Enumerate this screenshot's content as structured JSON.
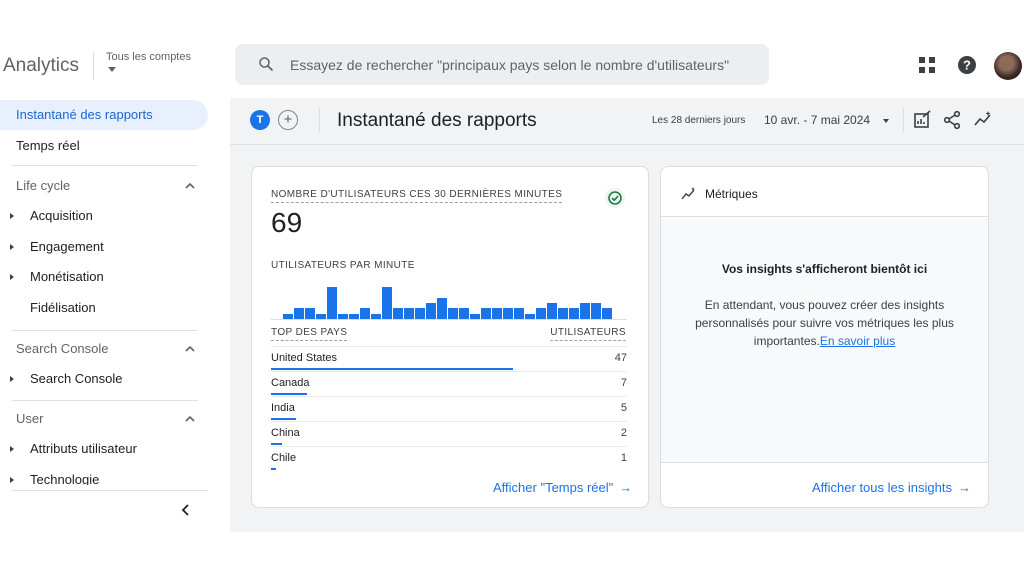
{
  "header": {
    "app_name": "Analytics",
    "account_label": "Tous les comptes",
    "search_placeholder": "Essayez de rechercher \"principaux pays selon le nombre d'utilisateurs\"",
    "icons": [
      "apps-grid-icon",
      "help-icon",
      "avatar"
    ]
  },
  "sidebar": {
    "items": [
      {
        "label": "Instantané des rapports",
        "active": true
      },
      {
        "label": "Temps réel",
        "active": false
      }
    ],
    "sections": [
      {
        "title": "Life cycle",
        "items": [
          "Acquisition",
          "Engagement",
          "Monétisation",
          "Fidélisation"
        ]
      },
      {
        "title": "Search Console",
        "items": [
          "Search Console"
        ]
      },
      {
        "title": "User",
        "items": [
          "Attributs utilisateur",
          "Technologie"
        ]
      }
    ]
  },
  "toolbar": {
    "badge_letter": "T",
    "add_symbol": "+",
    "title": "Instantané des rapports",
    "date_range_label": "Les 28 derniers jours",
    "date_range_value": "10 avr. - 7 mai 2024"
  },
  "realtime_card": {
    "kpi_label": "NOMBRE D'UTILISATEURS CES 30 DERNIÈRES MINUTES",
    "kpi_value": "69",
    "per_minute_label": "UTILISATEURS PAR MINUTE",
    "per_minute_values": [
      1,
      2,
      2,
      1,
      6,
      1,
      1,
      2,
      1,
      6,
      2,
      2,
      2,
      3,
      4,
      2,
      2,
      1,
      2,
      2,
      2,
      2,
      1,
      2,
      3,
      2,
      2,
      3,
      3,
      2
    ],
    "table_headers": {
      "country": "TOP DES PAYS",
      "users": "UTILISATEURS"
    },
    "rows": [
      {
        "country": "United States",
        "users": "47",
        "share": 0.68
      },
      {
        "country": "Canada",
        "users": "7",
        "share": 0.1
      },
      {
        "country": "India",
        "users": "5",
        "share": 0.07
      },
      {
        "country": "China",
        "users": "2",
        "share": 0.03
      },
      {
        "country": "Chile",
        "users": "1",
        "share": 0.015
      }
    ],
    "link_label": "Afficher \"Temps réel\"",
    "link_arrow": "→"
  },
  "metrics_card": {
    "title": "Métriques",
    "insights_title": "Vos insights s'afficheront bientôt ici",
    "insights_text": "En attendant, vous pouvez créer des insights personnalisés pour suivre vos métriques les plus importantes.",
    "insights_link": "En savoir plus",
    "footer_link": "Afficher tous les insights",
    "footer_arrow": "→"
  },
  "colors": {
    "accent": "#1a73e8",
    "active_bg": "#e8f0fe",
    "success": "#188038"
  }
}
